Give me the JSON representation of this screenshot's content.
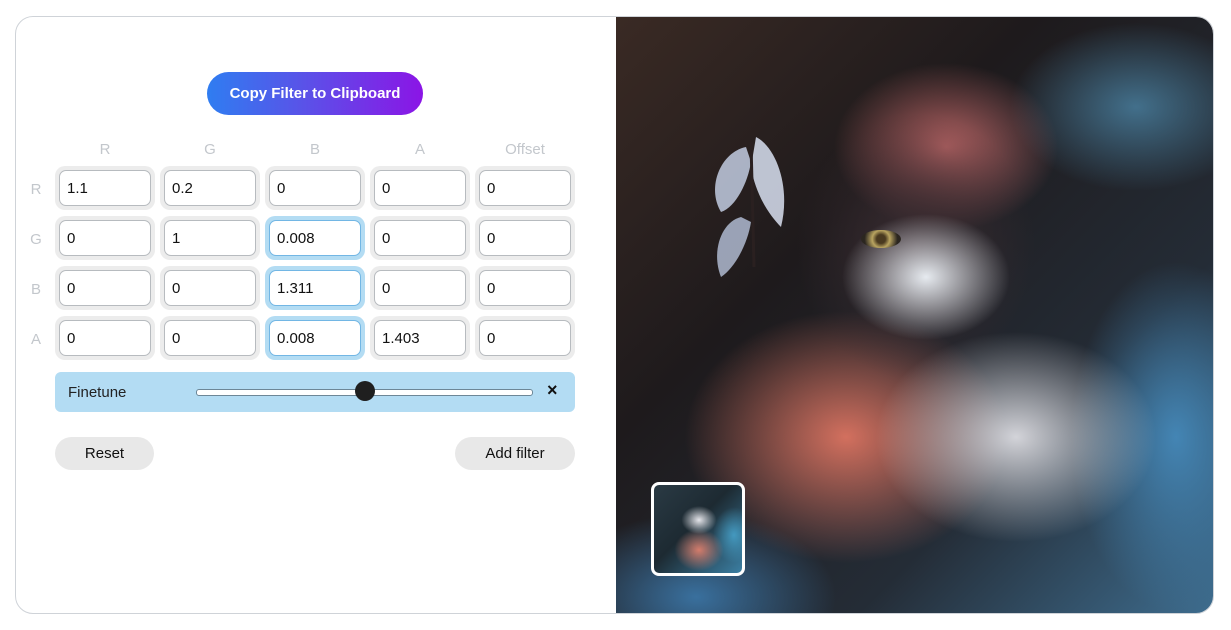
{
  "toolbar": {
    "copy_label": "Copy Filter to Clipboard"
  },
  "matrix": {
    "columns": [
      "R",
      "G",
      "B",
      "A",
      "Offset"
    ],
    "rows": [
      "R",
      "G",
      "B",
      "A"
    ],
    "values": [
      [
        "1.1",
        "0.2",
        "0",
        "0",
        "0"
      ],
      [
        "0",
        "1",
        "0.008",
        "0",
        "0"
      ],
      [
        "0",
        "0",
        "1.311",
        "0",
        "0"
      ],
      [
        "0",
        "0",
        "0.008",
        "1.403",
        "0"
      ]
    ]
  },
  "finetune": {
    "label": "Finetune",
    "close_symbol": "×",
    "level": 0.5
  },
  "actions": {
    "reset_label": "Reset",
    "add_label": "Add filter"
  },
  "colors": {
    "accent_start": "#2f7df1",
    "accent_end": "#8b15e6",
    "highlight": "#b3dcf3"
  },
  "preview": {
    "subject": "cat-with-butterfly-photo"
  }
}
